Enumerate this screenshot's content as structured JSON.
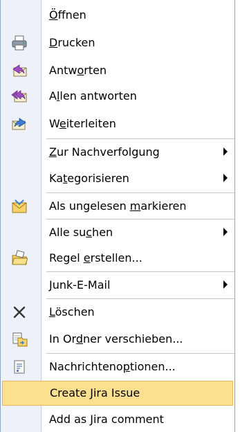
{
  "menu": {
    "items": [
      {
        "pre": "",
        "ul": "Ö",
        "post": "ffnen",
        "icon": "",
        "submenu": false,
        "highlight": false
      },
      {
        "pre": "",
        "ul": "D",
        "post": "rucken",
        "icon": "printer-icon",
        "submenu": false,
        "highlight": false
      },
      {
        "pre": "Antw",
        "ul": "o",
        "post": "rten",
        "icon": "reply-icon",
        "submenu": false,
        "highlight": false
      },
      {
        "pre": "A",
        "ul": "l",
        "post": "len antworten",
        "icon": "reply-all-icon",
        "submenu": false,
        "highlight": false
      },
      {
        "pre": "W",
        "ul": "e",
        "post": "iterleiten",
        "icon": "forward-icon",
        "submenu": false,
        "highlight": false
      },
      {
        "pre": "",
        "ul": "Z",
        "post": "ur Nachverfolgung",
        "icon": "",
        "submenu": true,
        "highlight": false
      },
      {
        "pre": "Ka",
        "ul": "t",
        "post": "egorisieren",
        "icon": "",
        "submenu": true,
        "highlight": false
      },
      {
        "pre": "Als ungelesen ",
        "ul": "m",
        "post": "arkieren",
        "icon": "mark-unread-icon",
        "submenu": false,
        "highlight": false
      },
      {
        "pre": "Alle su",
        "ul": "c",
        "post": "hen",
        "icon": "",
        "submenu": true,
        "highlight": false
      },
      {
        "pre": "Regel ",
        "ul": "e",
        "post": "rstellen...",
        "icon": "create-rule-icon",
        "submenu": false,
        "highlight": false
      },
      {
        "pre": "",
        "ul": "J",
        "post": "unk-E-Mail",
        "icon": "",
        "submenu": true,
        "highlight": false
      },
      {
        "pre": "",
        "ul": "L",
        "post": "öschen",
        "icon": "delete-icon",
        "submenu": false,
        "highlight": false
      },
      {
        "pre": "In Or",
        "ul": "d",
        "post": "ner verschieben...",
        "icon": "move-to-folder-icon",
        "submenu": false,
        "highlight": false
      },
      {
        "pre": "Nachrichteno",
        "ul": "p",
        "post": "tionen...",
        "icon": "message-options-icon",
        "submenu": false,
        "highlight": false
      },
      {
        "pre": "Create Jira Issue",
        "ul": "",
        "post": "",
        "icon": "",
        "submenu": false,
        "highlight": true
      },
      {
        "pre": "Add as Jira comment",
        "ul": "",
        "post": "",
        "icon": "",
        "submenu": false,
        "highlight": false
      }
    ]
  },
  "colors": {
    "highlight": "#fcdf8f",
    "highlight_border": "#e9b859",
    "icon_strip": "#eef2f8",
    "menu_border": "#8aa7c7"
  }
}
